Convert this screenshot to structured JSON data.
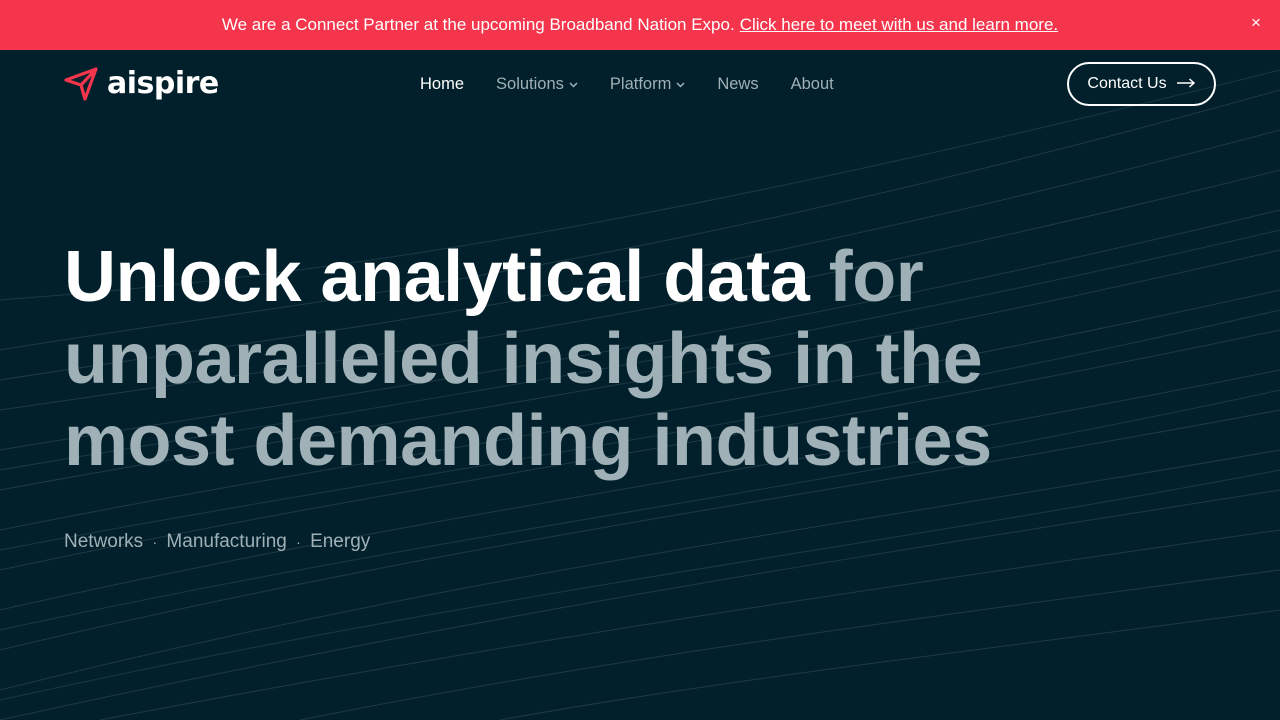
{
  "banner": {
    "message": "We are a Connect Partner at the upcoming Broadband Nation Expo.",
    "link_text": "Click here to meet with us and learn more.",
    "close_label": "×",
    "background": "#f4354c"
  },
  "logo": {
    "wordmark": "aispire",
    "icon": "paper-plane-logo-icon",
    "accent": "#f4354c"
  },
  "nav": {
    "items": [
      {
        "label": "Home",
        "active": true
      },
      {
        "label": "Solutions",
        "dropdown": true
      },
      {
        "label": "Platform",
        "dropdown": true
      },
      {
        "label": "News"
      },
      {
        "label": "About"
      }
    ],
    "chevron": "⌄"
  },
  "header": {
    "contact_label": "Contact Us",
    "contact_icon": "arrow-right-icon"
  },
  "hero": {
    "headline_strong": "Unlock analytical data",
    "headline_rest": "for unparalleled insights in the most demanding industries",
    "sectors": [
      "Networks",
      "Manufacturing",
      "Energy"
    ],
    "separator": "·"
  },
  "colors": {
    "background": "#01202b",
    "muted_text": "#9fb0b6",
    "text": "#ffffff"
  }
}
